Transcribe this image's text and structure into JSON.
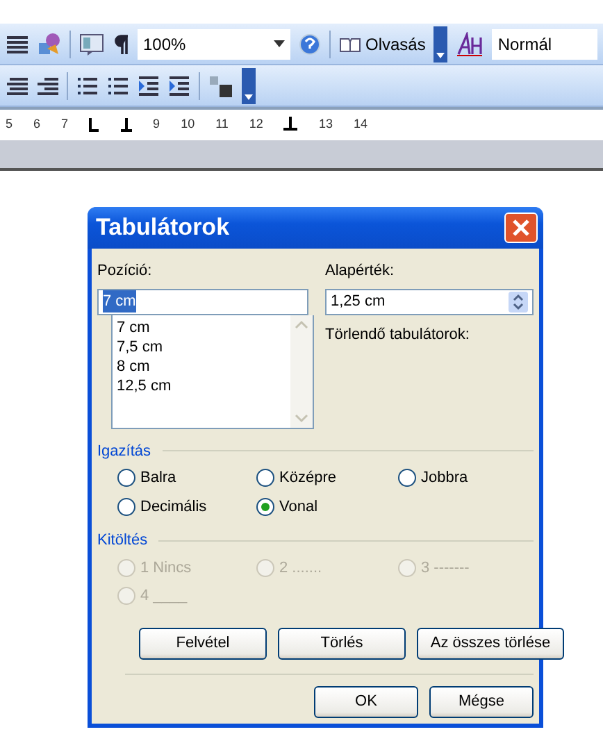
{
  "toolbar": {
    "zoom": "100%",
    "reading_button": "Olvasás",
    "style": "Normál"
  },
  "ruler": {
    "numbers": [
      "5",
      "6",
      "7",
      "9",
      "10",
      "11",
      "12",
      "13",
      "14"
    ]
  },
  "dialog": {
    "title": "Tabulátorok",
    "position": {
      "label": "Pozíció:",
      "value": "7 cm",
      "value_selected": true
    },
    "stops": [
      "7 cm",
      "7,5 cm",
      "8 cm",
      "12,5 cm"
    ],
    "default_stop": {
      "label": "Alapérték:",
      "value": "1,25 cm"
    },
    "clear_label": "Törlendő tabulátorok:",
    "alignment": {
      "title": "Igazítás",
      "options": [
        {
          "label": "Balra",
          "selected": false
        },
        {
          "label": "Középre",
          "selected": false
        },
        {
          "label": "Jobbra",
          "selected": false
        },
        {
          "label": "Decimális",
          "selected": false
        },
        {
          "label": "Vonal",
          "selected": true
        }
      ]
    },
    "leader": {
      "title": "Kitöltés",
      "disabled": true,
      "options": [
        {
          "label": "1 Nincs",
          "selected": false
        },
        {
          "label": "2 .......",
          "selected": false
        },
        {
          "label": "3 -------",
          "selected": false
        },
        {
          "label": "4 ____",
          "selected": false
        }
      ]
    },
    "buttons": [
      "Felvétel",
      "Törlés",
      "Az összes törlése"
    ],
    "footer_buttons": [
      "OK",
      "Mégse"
    ]
  }
}
